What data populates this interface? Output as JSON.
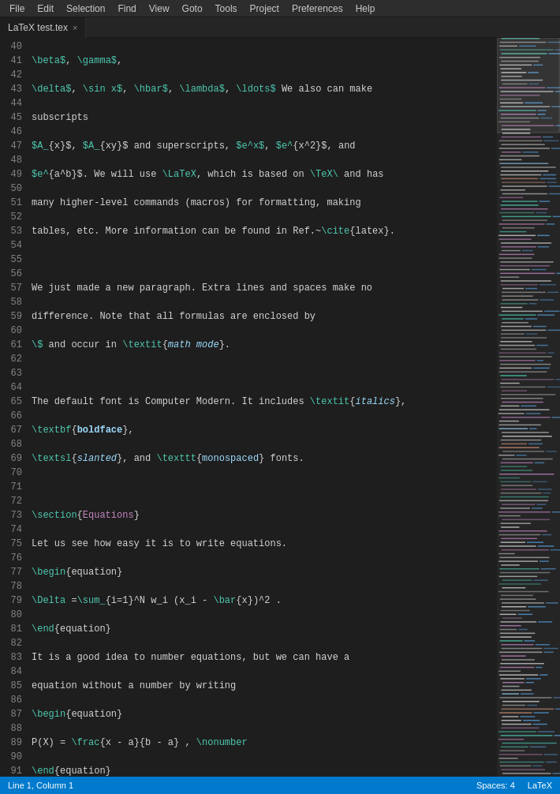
{
  "menubar": {
    "items": [
      "File",
      "Edit",
      "Selection",
      "Find",
      "View",
      "Goto",
      "Tools",
      "Project",
      "Preferences",
      "Help"
    ]
  },
  "tab": {
    "label": "LaTeX test.tex",
    "close": "×"
  },
  "statusbar": {
    "line": "Line 1, Column 1",
    "spaces": "Spaces: 4",
    "language": "LaTeX"
  },
  "lines": {
    "start": 40
  }
}
